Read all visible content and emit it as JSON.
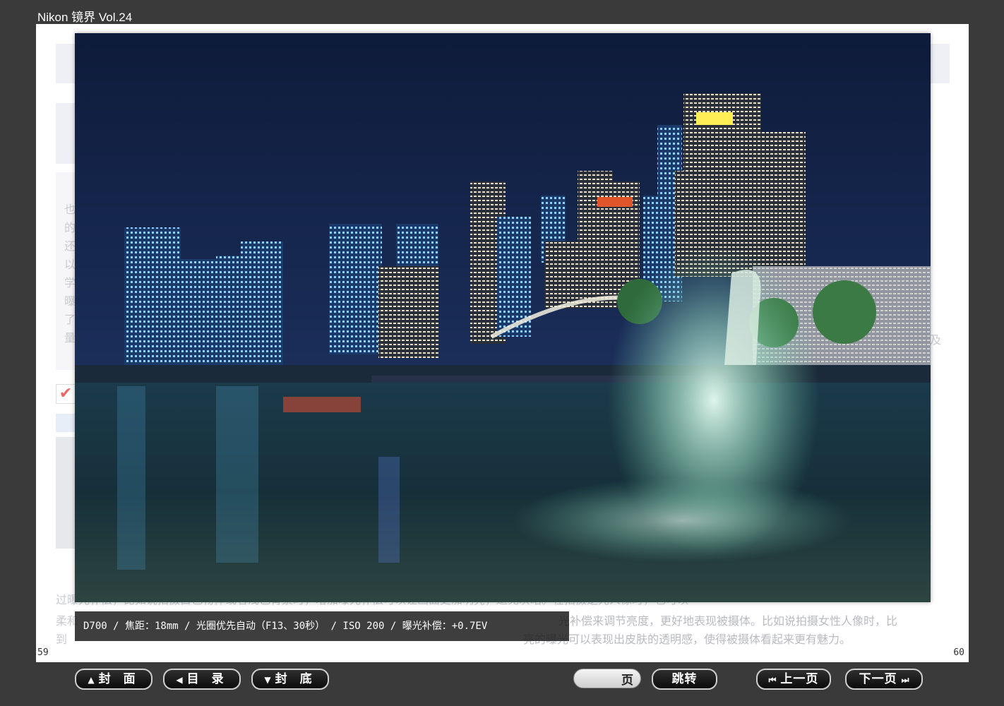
{
  "app": {
    "title": "Nikon 镜界 Vol.24"
  },
  "spread": {
    "left_page_number": "59",
    "right_page_number": "60",
    "background_lines": [
      "过曝光补偿，比如说拍摄白色物体或者浅色背景时，增加曝光补偿可以让画面更加明亮，避免灰暗。在拍摄逆光人像时，也可以",
      "柔和",
      "到"
    ],
    "background_right_lines": [
      "光补偿来调节亮度，更好地表现被摄体。比如说拍摄女性人像时，比",
      "亮的曝光可以表现出皮肤的透明感，使得被摄体看起来更有魅力。"
    ],
    "side_chars": [
      "也",
      "的",
      "还",
      "以",
      "学",
      "曝",
      "了",
      "量"
    ],
    "side_right_text": "以及"
  },
  "photo": {
    "alt": "Singapore Merlion night skyline",
    "caption": "D700 / 焦距：18mm / 光圈优先自动（F13、30秒） / ISO 200 / 曝光补偿：+0.7EV"
  },
  "toolbar": {
    "cover_label": "封 面",
    "toc_label": "目 录",
    "back_cover_label": "封 底",
    "page_suffix": "页",
    "page_value": "",
    "jump_label": "跳转",
    "prev_label": "上一页",
    "next_label": "下一页"
  }
}
